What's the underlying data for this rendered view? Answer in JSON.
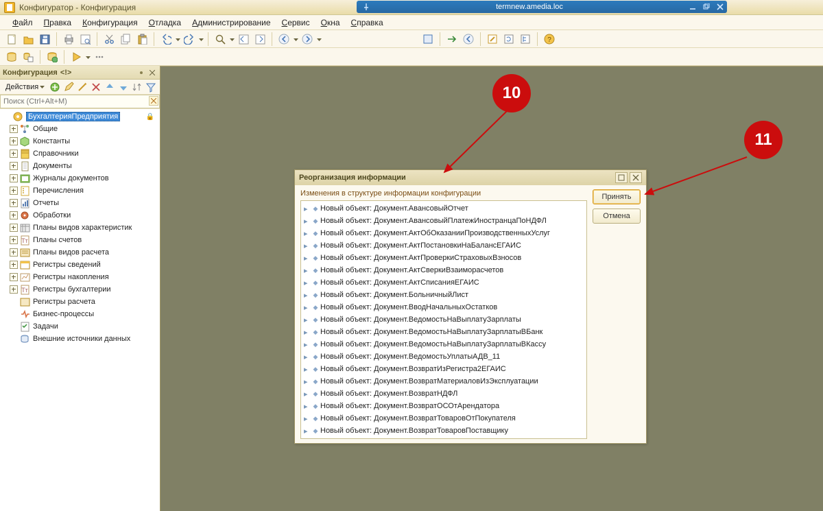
{
  "remote": {
    "host": "termnew.amedia.loc"
  },
  "app": {
    "title": "Конфигуратор - Конфигурация"
  },
  "menu": [
    "Файл",
    "Правка",
    "Конфигурация",
    "Отладка",
    "Администрирование",
    "Сервис",
    "Окна",
    "Справка"
  ],
  "panel": {
    "title": "Конфигурация",
    "warn": "<!>",
    "actions": "Действия",
    "search_placeholder": "Поиск (Ctrl+Alt+M)",
    "root": "БухгалтерияПредприятия"
  },
  "tree_items": [
    {
      "label": "Общие",
      "icon": "branches"
    },
    {
      "label": "Константы",
      "icon": "cube-green"
    },
    {
      "label": "Справочники",
      "icon": "book-yellow"
    },
    {
      "label": "Документы",
      "icon": "doc"
    },
    {
      "label": "Журналы документов",
      "icon": "journal"
    },
    {
      "label": "Перечисления",
      "icon": "list-yellow"
    },
    {
      "label": "Отчеты",
      "icon": "report"
    },
    {
      "label": "Обработки",
      "icon": "gear-red"
    },
    {
      "label": "Планы видов характеристик",
      "icon": "plan"
    },
    {
      "label": "Планы счетов",
      "icon": "tplan"
    },
    {
      "label": "Планы видов расчета",
      "icon": "cplan"
    },
    {
      "label": "Регистры сведений",
      "icon": "reginfo"
    },
    {
      "label": "Регистры накопления",
      "icon": "regacc"
    },
    {
      "label": "Регистры бухгалтерии",
      "icon": "regbuh"
    },
    {
      "label": "Регистры расчета",
      "icon": "regcalc"
    },
    {
      "label": "Бизнес-процессы",
      "icon": "bproc"
    },
    {
      "label": "Задачи",
      "icon": "task"
    },
    {
      "label": "Внешние источники данных",
      "icon": "extds"
    }
  ],
  "dialog": {
    "title": "Реорганизация информации",
    "caption": "Изменения в структуре информации конфигурации",
    "accept": "Принять",
    "cancel": "Отмена",
    "prefix": "Новый объект: ",
    "items": [
      "Документ.АвансовыйОтчет",
      "Документ.АвансовыйПлатежИностранцаПоНДФЛ",
      "Документ.АктОбОказанииПроизводственныхУслуг",
      "Документ.АктПостановкиНаБалансЕГАИС",
      "Документ.АктПроверкиСтраховыхВзносов",
      "Документ.АктСверкиВзаиморасчетов",
      "Документ.АктСписанияЕГАИС",
      "Документ.БольничныйЛист",
      "Документ.ВводНачальныхОстатков",
      "Документ.ВедомостьНаВыплатуЗарплаты",
      "Документ.ВедомостьНаВыплатуЗарплатыВБанк",
      "Документ.ВедомостьНаВыплатуЗарплатыВКассу",
      "Документ.ВедомостьУплатыАДВ_11",
      "Документ.ВозвратИзРегистра2ЕГАИС",
      "Документ.ВозвратМатериаловИзЭксплуатации",
      "Документ.ВозвратНДФЛ",
      "Документ.ВозвратОСОтАрендатора",
      "Документ.ВозвратТоваровОтПокупателя",
      "Документ.ВозвратТоваровПоставщику"
    ]
  },
  "callouts": {
    "a": "10",
    "b": "11"
  },
  "icons": {
    "toolbar1": [
      "new-doc",
      "open",
      "save",
      "sep",
      "print",
      "preview",
      "sep",
      "cut",
      "copy",
      "paste",
      "sep",
      "undo-drop",
      "redo-drop",
      "sep",
      "search-drop",
      "find-prev",
      "find-next",
      "sep",
      "nav-back-drop",
      "nav-fwd-drop"
    ],
    "toolbar2": [
      "db",
      "db-copy",
      "sep",
      "db-planet",
      "sep",
      "run-drop",
      "more"
    ],
    "toolbar1b": [
      "blue-sq",
      "sep",
      "arrow-right",
      "nav-back",
      "sep",
      "config-wand",
      "config-sync",
      "config-tree",
      "sep",
      "help-badge",
      "drop"
    ],
    "panel_actions": [
      "add",
      "edit",
      "wand",
      "delete",
      "up",
      "down",
      "sort",
      "filter"
    ]
  }
}
